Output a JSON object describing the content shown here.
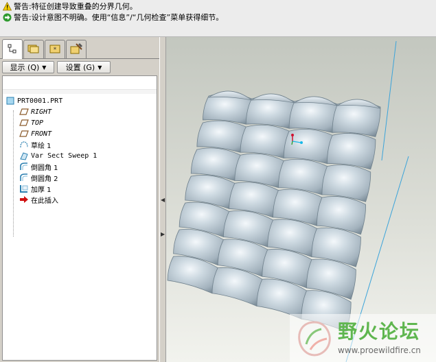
{
  "messages": [
    {
      "icon": "warning-icon",
      "text": "警告:特征创建导致重叠的分界几何。"
    },
    {
      "icon": "arrow-icon",
      "text": "警告:设计意图不明确。使用“信息”/“几何检查”菜单获得细节。"
    }
  ],
  "tabs": [
    {
      "name": "model-tree",
      "icon": "model-tree-icon"
    },
    {
      "name": "folder-browser",
      "icon": "folder-icon"
    },
    {
      "name": "favorites",
      "icon": "favorites-icon"
    },
    {
      "name": "connections",
      "icon": "connections-icon"
    }
  ],
  "toolbar": {
    "show_label": "显示 (Q)",
    "settings_label": "设置 (G)"
  },
  "tree": {
    "root": "PRT0001.PRT",
    "items": [
      {
        "label": "RIGHT",
        "icon": "datum-plane-icon"
      },
      {
        "label": "TOP",
        "icon": "datum-plane-icon"
      },
      {
        "label": "FRONT",
        "icon": "datum-plane-icon"
      },
      {
        "label": "草绘 1",
        "icon": "sketch-icon"
      },
      {
        "label": "Var Sect Sweep 1",
        "icon": "sweep-icon"
      },
      {
        "label": "倒圆角 1",
        "icon": "round-icon"
      },
      {
        "label": "倒圆角 2",
        "icon": "round-icon"
      },
      {
        "label": "加厚 1",
        "icon": "thicken-icon"
      },
      {
        "label": "在此插入",
        "icon": "insert-here-icon"
      }
    ]
  },
  "watermark": {
    "title": "野火论坛",
    "url": "www.proewildfire.cn"
  },
  "colors": {
    "viewport_top": "#c4c8c1",
    "viewport_bottom": "#f0f1ec",
    "surface": "#b7c3cb",
    "surface_highlight": "#eef3f6",
    "surface_shadow": "#7f8f9a",
    "datum_line": "#38a8e0",
    "watermark_green": "#5fb64f"
  }
}
